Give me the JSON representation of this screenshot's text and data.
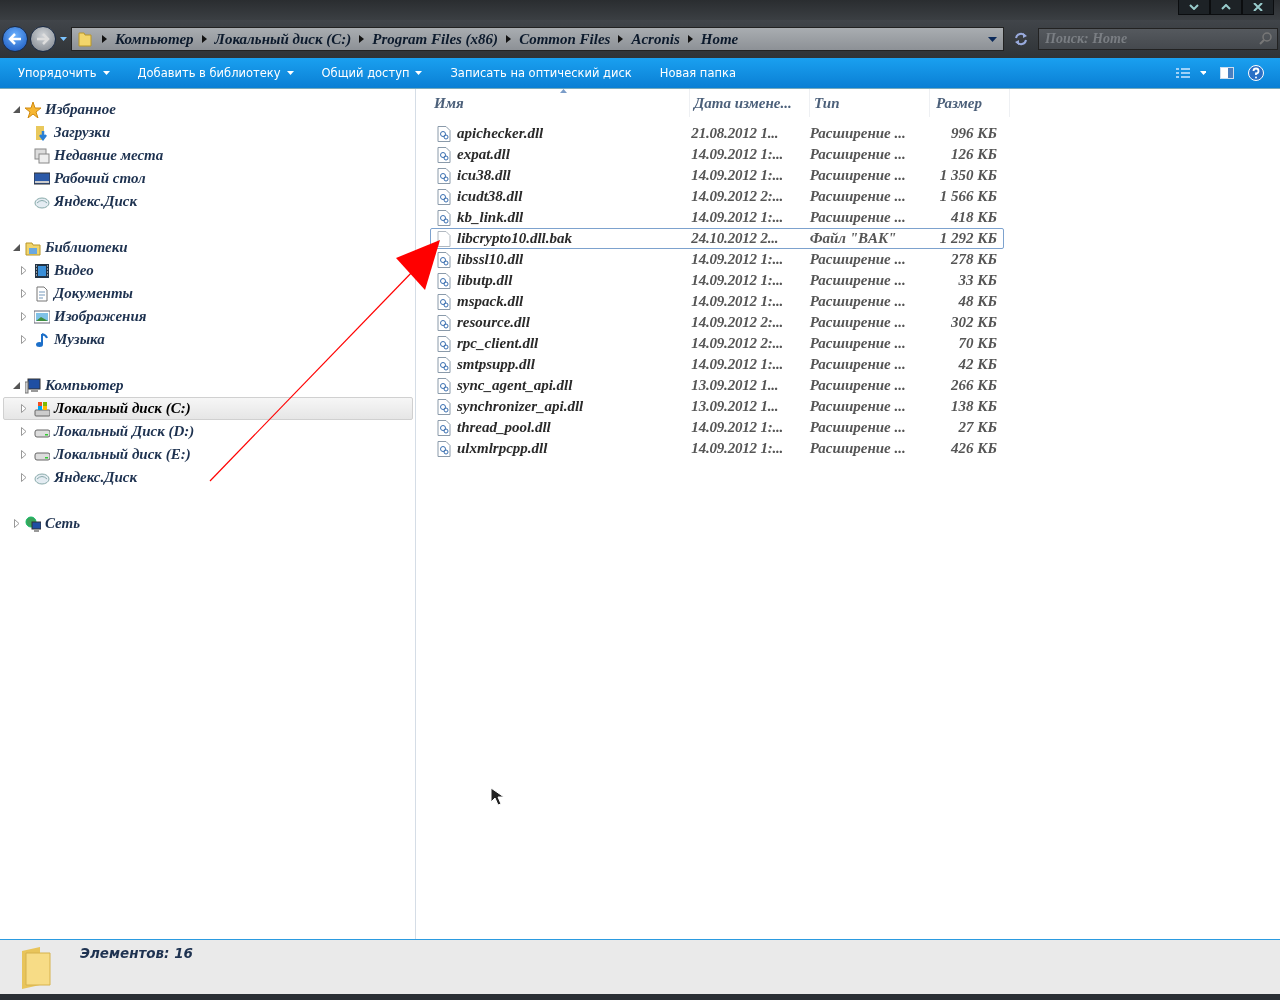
{
  "address_bar": {
    "breadcrumbs": [
      "Компьютер",
      "Локальный диск (C:)",
      "Program Files (x86)",
      "Common Files",
      "Acronis",
      "Home"
    ],
    "search": {
      "placeholder": "Поиск: Home"
    }
  },
  "toolbar": {
    "buttons": [
      {
        "label": "Упорядочить",
        "kind": "menu"
      },
      {
        "label": "Добавить в библиотеку",
        "kind": "menu"
      },
      {
        "label": "Общий доступ",
        "kind": "menu"
      },
      {
        "label": "Записать на оптический диск",
        "kind": "plain"
      },
      {
        "label": "Новая папка",
        "kind": "plain"
      }
    ]
  },
  "navigation": [
    {
      "label": "Избранное",
      "kind": "star",
      "expanded": true,
      "selected": false,
      "children": [
        {
          "label": "Загрузки",
          "kind": "downloads",
          "selected": false
        },
        {
          "label": "Недавние места",
          "kind": "recent",
          "selected": false
        },
        {
          "label": "Рабочий стол",
          "kind": "desktop",
          "selected": false
        },
        {
          "label": "Яндекс.Диск",
          "kind": "cloud",
          "selected": false
        }
      ]
    },
    {
      "label": "Библиотеки",
      "kind": "library",
      "expanded": true,
      "selected": false,
      "children": [
        {
          "label": "Видео",
          "kind": "video",
          "expanded": false,
          "selected": false
        },
        {
          "label": "Документы",
          "kind": "documents",
          "expanded": false,
          "selected": false
        },
        {
          "label": "Изображения",
          "kind": "pictures",
          "expanded": false,
          "selected": false
        },
        {
          "label": "Музыка",
          "kind": "music",
          "expanded": false,
          "selected": false
        }
      ]
    },
    {
      "label": "Компьютер",
      "kind": "computer",
      "expanded": true,
      "selected": false,
      "children": [
        {
          "label": "Локальный диск (C:)",
          "kind": "system-drive",
          "expanded": false,
          "selected": true
        },
        {
          "label": "Локальный Диск (D:)",
          "kind": "drive",
          "expanded": false,
          "selected": false
        },
        {
          "label": "Локальный диск (E:)",
          "kind": "drive",
          "expanded": false,
          "selected": false
        },
        {
          "label": "Яндекс.Диск",
          "kind": "cloud",
          "expanded": false,
          "selected": false
        }
      ]
    },
    {
      "label": "Сеть",
      "kind": "network",
      "expanded": false,
      "selected": false
    }
  ],
  "file_list": {
    "columns": [
      {
        "label": "Имя",
        "sorted": true
      },
      {
        "label": "Дата измене...",
        "sorted": false
      },
      {
        "label": "Тип",
        "sorted": false
      },
      {
        "label": "Размер",
        "sorted": false
      }
    ],
    "rows": [
      {
        "name": "apichecker.dll",
        "date": "21.08.2012 1...",
        "type": "Расширение ...",
        "size": "996 КБ",
        "kind": "library",
        "focused": false
      },
      {
        "name": "expat.dll",
        "date": "14.09.2012 1:...",
        "type": "Расширение ...",
        "size": "126 КБ",
        "kind": "library",
        "focused": false
      },
      {
        "name": "icu38.dll",
        "date": "14.09.2012 1:...",
        "type": "Расширение ...",
        "size": "1 350 КБ",
        "kind": "library",
        "focused": false
      },
      {
        "name": "icudt38.dll",
        "date": "14.09.2012 2:...",
        "type": "Расширение ...",
        "size": "1 566 КБ",
        "kind": "library",
        "focused": false
      },
      {
        "name": "kb_link.dll",
        "date": "14.09.2012 1:...",
        "type": "Расширение ...",
        "size": "418 КБ",
        "kind": "library",
        "focused": false
      },
      {
        "name": "libcrypto10.dll.bak",
        "date": "24.10.2012 2...",
        "type": "Файл \"BAK\"",
        "size": "1 292 КБ",
        "kind": "file",
        "focused": true
      },
      {
        "name": "libssl10.dll",
        "date": "14.09.2012 1:...",
        "type": "Расширение ...",
        "size": "278 КБ",
        "kind": "library",
        "focused": false
      },
      {
        "name": "libutp.dll",
        "date": "14.09.2012 1:...",
        "type": "Расширение ...",
        "size": "33 КБ",
        "kind": "library",
        "focused": false
      },
      {
        "name": "mspack.dll",
        "date": "14.09.2012 1:...",
        "type": "Расширение ...",
        "size": "48 КБ",
        "kind": "library",
        "focused": false
      },
      {
        "name": "resource.dll",
        "date": "14.09.2012 2:...",
        "type": "Расширение ...",
        "size": "302 КБ",
        "kind": "library",
        "focused": false
      },
      {
        "name": "rpc_client.dll",
        "date": "14.09.2012 2:...",
        "type": "Расширение ...",
        "size": "70 КБ",
        "kind": "library",
        "focused": false
      },
      {
        "name": "smtpsupp.dll",
        "date": "14.09.2012 1:...",
        "type": "Расширение ...",
        "size": "42 КБ",
        "kind": "library",
        "focused": false
      },
      {
        "name": "sync_agent_api.dll",
        "date": "13.09.2012 1...",
        "type": "Расширение ...",
        "size": "266 КБ",
        "kind": "library",
        "focused": false
      },
      {
        "name": "synchronizer_api.dll",
        "date": "13.09.2012 1...",
        "type": "Расширение ...",
        "size": "138 КБ",
        "kind": "library",
        "focused": false
      },
      {
        "name": "thread_pool.dll",
        "date": "14.09.2012 1:...",
        "type": "Расширение ...",
        "size": "27 КБ",
        "kind": "library",
        "focused": false
      },
      {
        "name": "ulxmlrpcpp.dll",
        "date": "14.09.2012 1:...",
        "type": "Расширение ...",
        "size": "426 КБ",
        "kind": "library",
        "focused": false
      }
    ]
  },
  "status_bar": {
    "text": "Элементов: 16"
  }
}
